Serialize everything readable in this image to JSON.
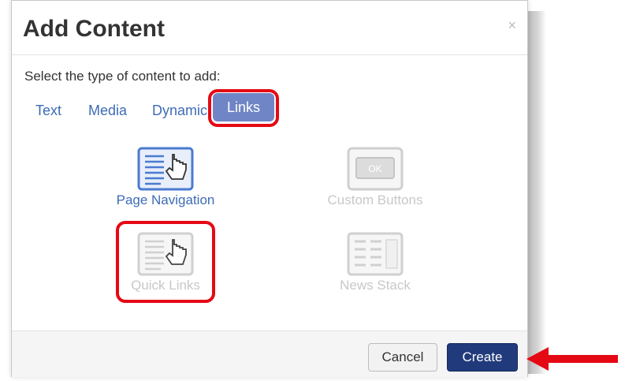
{
  "dialog": {
    "title": "Add Content",
    "close_symbol": "×",
    "prompt": "Select the type of content to add:"
  },
  "tabs": [
    {
      "label": "Text",
      "active": false
    },
    {
      "label": "Media",
      "active": false
    },
    {
      "label": "Dynamic",
      "active": false
    },
    {
      "label": "Links",
      "active": true
    }
  ],
  "options": [
    {
      "label": "Page Navigation",
      "icon": "page-navigation-icon",
      "enabled": true
    },
    {
      "label": "Custom Buttons",
      "icon": "custom-buttons-icon",
      "icon_text": "OK",
      "enabled": false
    },
    {
      "label": "Quick Links",
      "icon": "quick-links-icon",
      "enabled": false
    },
    {
      "label": "News Stack",
      "icon": "news-stack-icon",
      "enabled": false
    }
  ],
  "footer": {
    "cancel_label": "Cancel",
    "create_label": "Create"
  },
  "colors": {
    "accent_blue": "#3d6cb5",
    "active_tab": "#6f85c5",
    "primary_button": "#213a7c",
    "highlight_red": "#e50914"
  }
}
